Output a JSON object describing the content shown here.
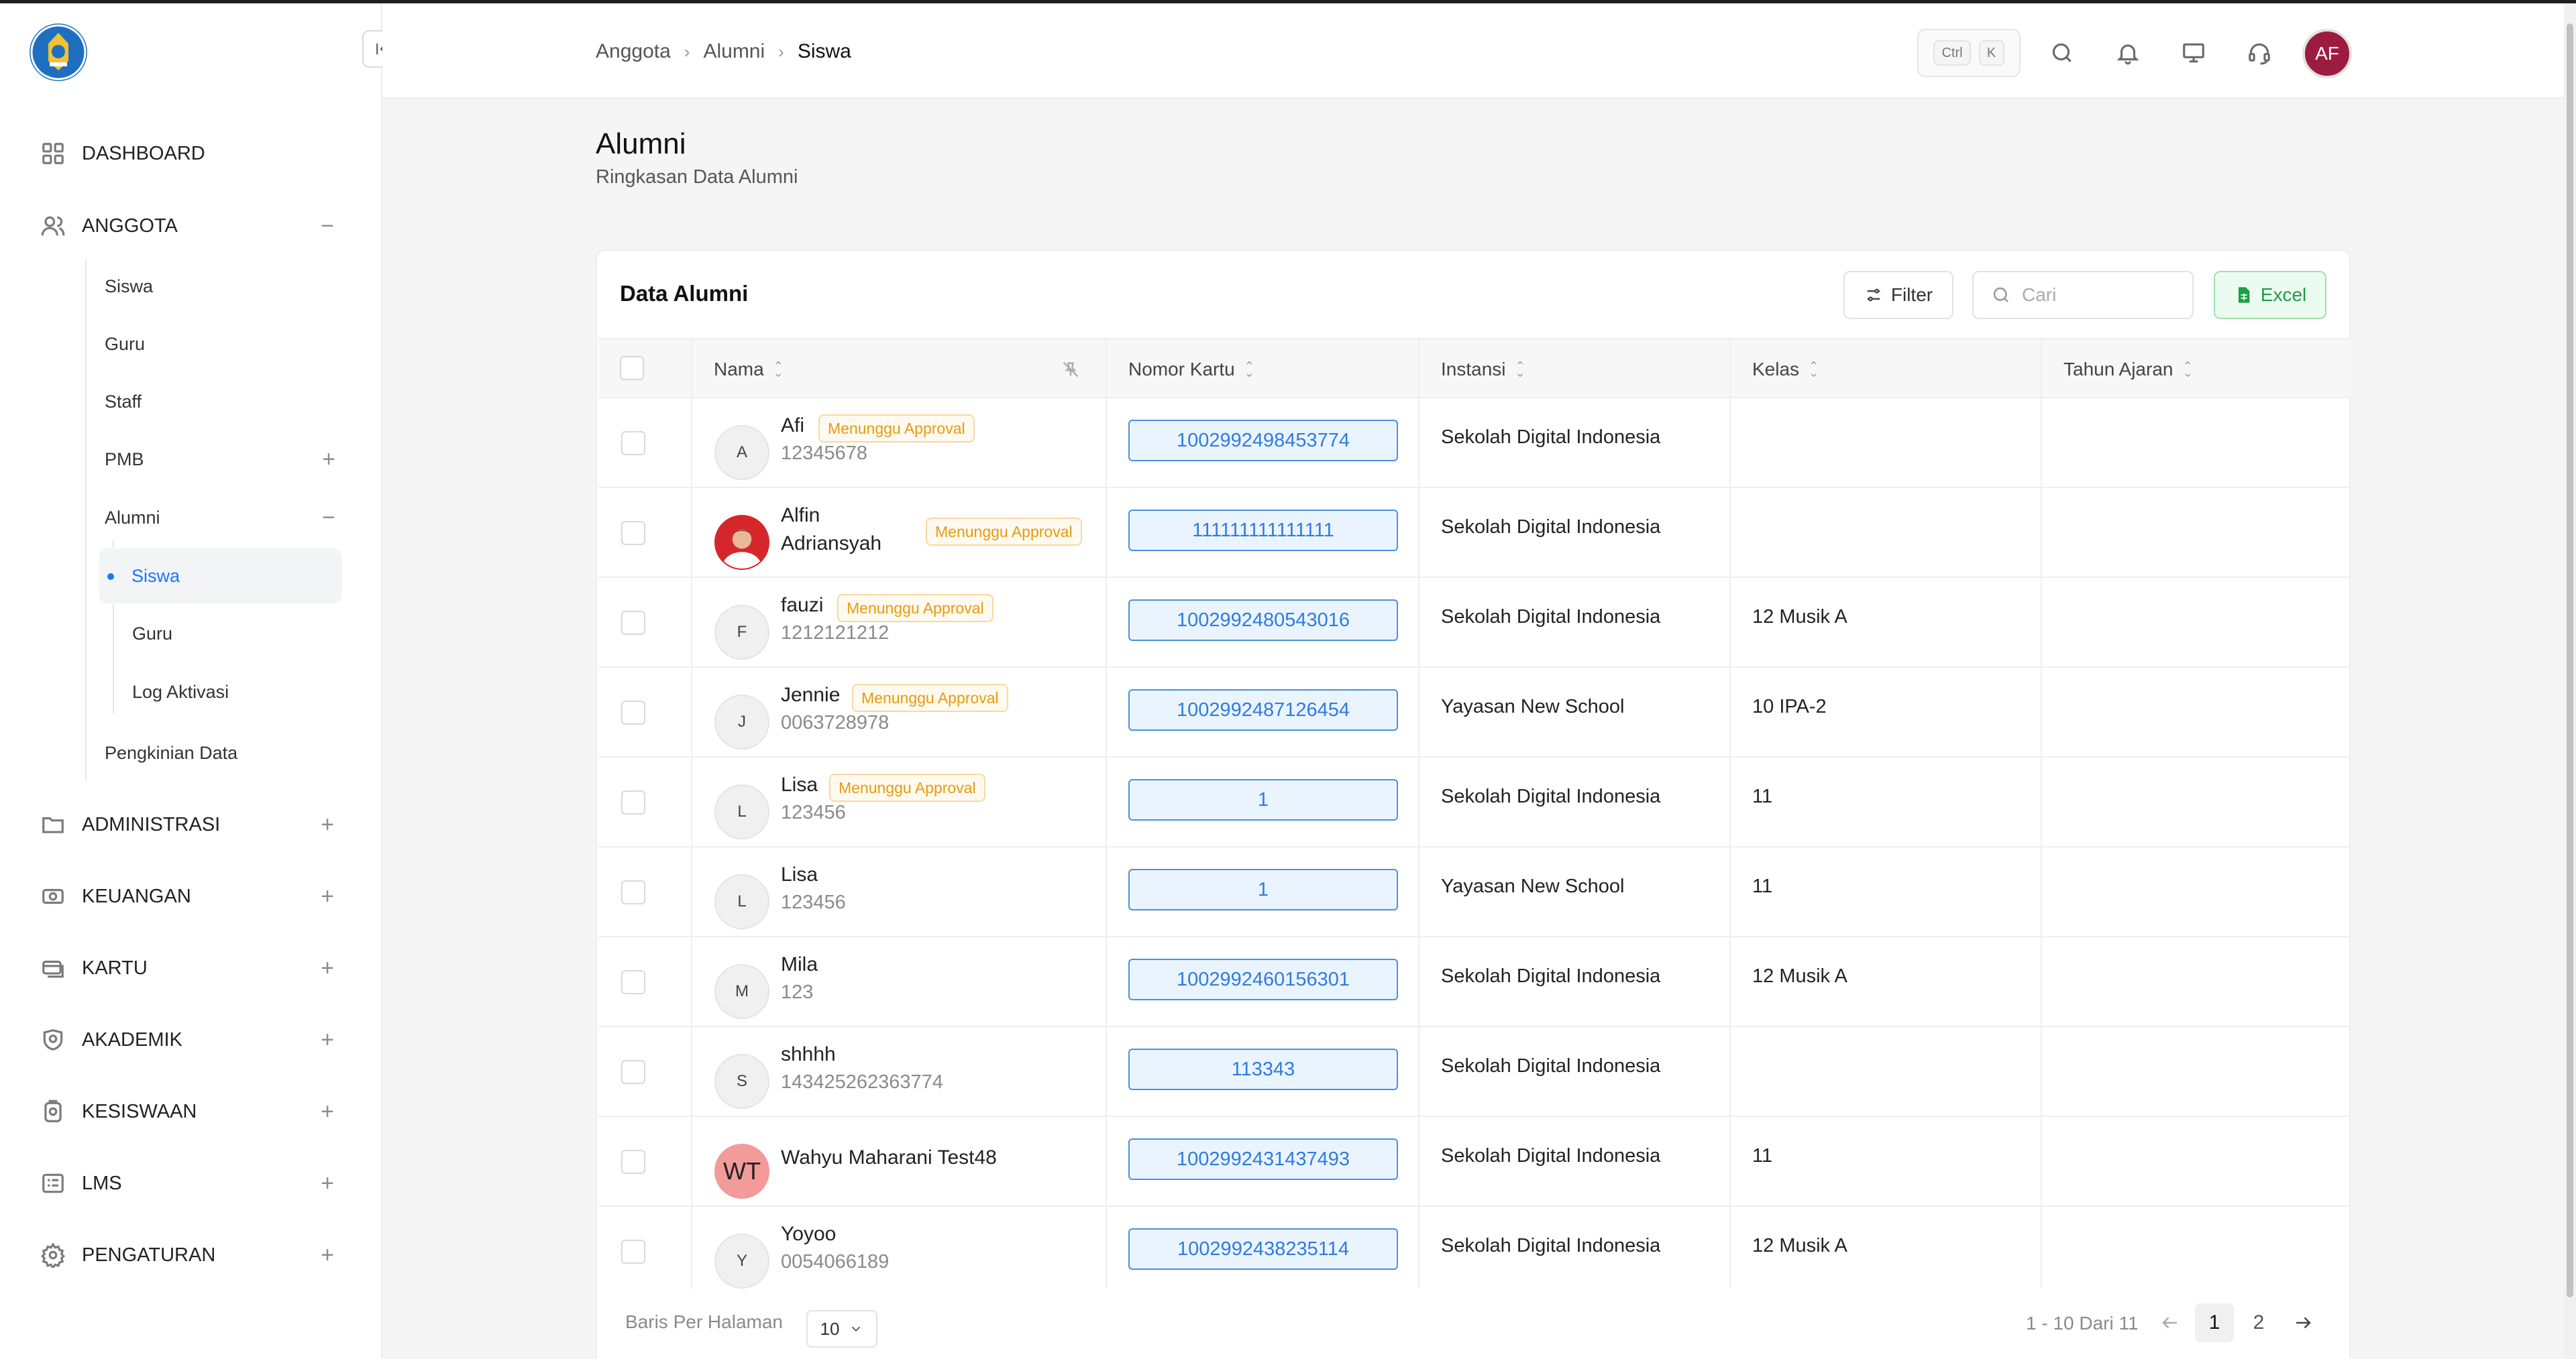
{
  "header": {
    "breadcrumb": [
      "Anggota",
      "Alumni",
      "Siswa"
    ],
    "shortcut": [
      "Ctrl",
      "K"
    ],
    "avatar_initials": "AF"
  },
  "sidebar": {
    "items": [
      {
        "label": "DASHBOARD",
        "icon": "grid-icon"
      },
      {
        "label": "ANGGOTA",
        "icon": "users-icon",
        "toggle": "−"
      },
      {
        "label": "ADMINISTRASI",
        "icon": "folder-icon",
        "toggle": "+"
      },
      {
        "label": "KEUANGAN",
        "icon": "money-icon",
        "toggle": "+"
      },
      {
        "label": "KARTU",
        "icon": "card-icon",
        "toggle": "+"
      },
      {
        "label": "AKADEMIK",
        "icon": "academic-icon",
        "toggle": "+"
      },
      {
        "label": "KESISWAAN",
        "icon": "student-icon",
        "toggle": "+"
      },
      {
        "label": "LMS",
        "icon": "list-icon",
        "toggle": "+"
      },
      {
        "label": "PENGATURAN",
        "icon": "gear-icon",
        "toggle": "+"
      }
    ],
    "anggota_sub": [
      {
        "label": "Siswa"
      },
      {
        "label": "Guru"
      },
      {
        "label": "Staff"
      },
      {
        "label": "PMB",
        "toggle": "+"
      },
      {
        "label": "Alumni",
        "toggle": "−"
      },
      {
        "label": "Pengkinian Data"
      }
    ],
    "alumni_sub": [
      {
        "label": "Siswa",
        "active": true
      },
      {
        "label": "Guru"
      },
      {
        "label": "Log Aktivasi"
      }
    ]
  },
  "page": {
    "title": "Alumni",
    "subtitle": "Ringkasan Data Alumni"
  },
  "card": {
    "title": "Data Alumni",
    "filter_label": "Filter",
    "search_placeholder": "Cari",
    "excel_label": "Excel"
  },
  "table": {
    "columns": [
      "Nama",
      "Nomor Kartu",
      "Instansi",
      "Kelas",
      "Tahun Ajaran"
    ],
    "rows": [
      {
        "initial": "A",
        "name": "Afi",
        "sub": "12345678",
        "badge": "Menunggu Approval",
        "card": "1002992498453774",
        "instansi": "Sekolah Digital Indonesia",
        "kelas": "",
        "tahun": ""
      },
      {
        "initial": "",
        "name": "Alfin",
        "name2": "Adriansyah",
        "sub": "",
        "badge": "Menunggu Approval",
        "card": "111111111111111",
        "instansi": "Sekolah Digital Indonesia",
        "kelas": "",
        "tahun": ""
      },
      {
        "initial": "F",
        "name": "fauzi",
        "sub": "1212121212",
        "badge": "Menunggu Approval",
        "card": "1002992480543016",
        "instansi": "Sekolah Digital Indonesia",
        "kelas": "12 Musik A",
        "tahun": ""
      },
      {
        "initial": "J",
        "name": "Jennie",
        "sub": "0063728978",
        "badge": "Menunggu Approval",
        "card": "1002992487126454",
        "instansi": "Yayasan New School",
        "kelas": "10 IPA-2",
        "tahun": ""
      },
      {
        "initial": "L",
        "name": "Lisa",
        "sub": "123456",
        "badge": "Menunggu Approval",
        "card": "1",
        "instansi": "Sekolah Digital Indonesia",
        "kelas": "11",
        "tahun": ""
      },
      {
        "initial": "L",
        "name": "Lisa",
        "sub": "123456",
        "badge": "",
        "card": "1",
        "instansi": "Yayasan New School",
        "kelas": "11",
        "tahun": ""
      },
      {
        "initial": "M",
        "name": "Mila",
        "sub": "123",
        "badge": "",
        "card": "1002992460156301",
        "instansi": "Sekolah Digital Indonesia",
        "kelas": "12 Musik A",
        "tahun": ""
      },
      {
        "initial": "S",
        "name": "shhhh",
        "sub": "143425262363774",
        "badge": "",
        "card": "113343",
        "instansi": "Sekolah Digital Indonesia",
        "kelas": "",
        "tahun": ""
      },
      {
        "initial": "WT",
        "name": "Wahyu Maharani Test48",
        "sub": "",
        "badge": "",
        "card": "1002992431437493",
        "instansi": "Sekolah Digital Indonesia",
        "kelas": "11",
        "tahun": ""
      },
      {
        "initial": "Y",
        "name": "Yoyoo",
        "sub": "0054066189",
        "badge": "",
        "card": "1002992438235114",
        "instansi": "Sekolah Digital Indonesia",
        "kelas": "12 Musik A",
        "tahun": ""
      }
    ]
  },
  "footer": {
    "rows_label": "Baris Per Halaman",
    "rows_value": "10",
    "range": "1 - 10 Dari 11",
    "pages": [
      "1",
      "2"
    ],
    "current_page": "1"
  },
  "colors": {
    "accent": "#1677ff",
    "badge": "#e89a0d",
    "excel": "#1a9e48",
    "avatar": "#9c1c3f"
  }
}
